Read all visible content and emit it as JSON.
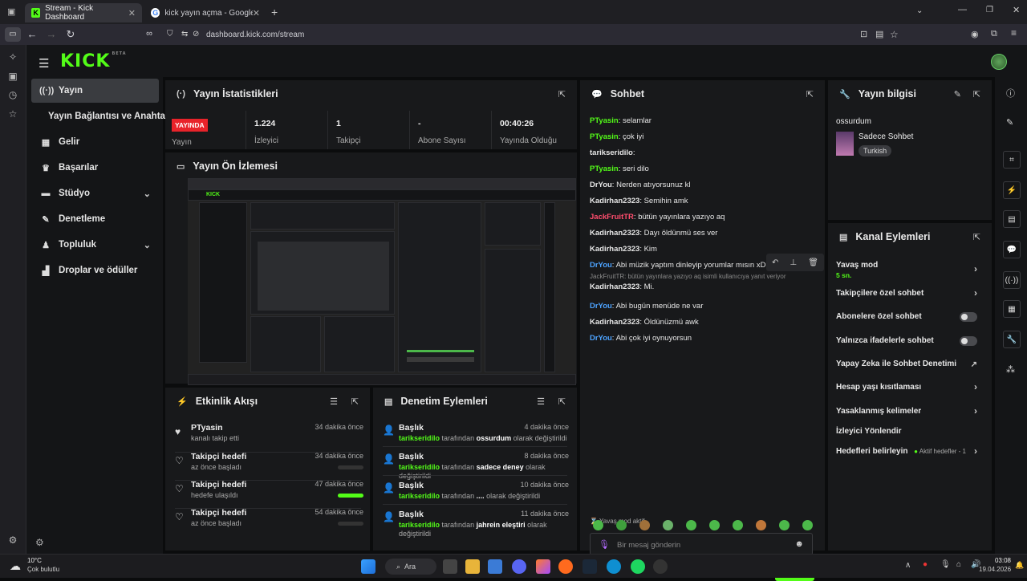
{
  "browser": {
    "tabs": [
      {
        "title": "Stream - Kick Dashboard",
        "active": true
      },
      {
        "title": "kick yayın açma - Google'da Ara",
        "active": false
      }
    ],
    "url": "dashboard.kick.com/stream"
  },
  "nav": {
    "items": [
      {
        "label": "Yayın",
        "icon": "broadcast-icon",
        "active": true
      },
      {
        "label": "Yayın Bağlantısı ve Anahtarı"
      },
      {
        "label": "Gelir",
        "icon": "revenue-icon"
      },
      {
        "label": "Başarılar",
        "icon": "trophy-icon"
      },
      {
        "label": "Stüdyo",
        "icon": "studio-icon"
      },
      {
        "label": "Denetleme",
        "icon": "wrench-icon"
      },
      {
        "label": "Topluluk",
        "icon": "community-icon"
      },
      {
        "label": "Droplar ve ödüller",
        "icon": "drops-icon"
      }
    ]
  },
  "stats": {
    "title": "Yayın İstatistikleri",
    "live_badge": "YAYINDA",
    "live_label": "Yayın",
    "cells": [
      {
        "value": "1.224",
        "label": "İzleyici"
      },
      {
        "value": "1",
        "label": "Takipçi"
      },
      {
        "value": "-",
        "label": "Abone Sayısı"
      },
      {
        "value": "00:40:26",
        "label": "Yayında Olduğu"
      }
    ]
  },
  "preview": {
    "title": "Yayın Ön İzlemesi"
  },
  "activity": {
    "title": "Etkinlik Akışı",
    "items": [
      {
        "title": "PTyasin",
        "sub": "kanalı takip etti",
        "time": "34 dakika önce",
        "progress": null
      },
      {
        "title": "Takipçi hedefi",
        "sub": "az önce başladı",
        "time": "34 dakika önce",
        "progress": 0
      },
      {
        "title": "Takipçi hedefi",
        "sub": "hedefe ulaşıldı",
        "time": "47 dakika önce",
        "progress": 1
      },
      {
        "title": "Takipçi hedefi",
        "sub": "az önce başladı",
        "time": "54 dakika önce",
        "progress": 0
      }
    ]
  },
  "moderation": {
    "title": "Denetim Eylemleri",
    "items": [
      {
        "title": "Başlık",
        "time": "4 dakika önce",
        "user": "tarikseridilo",
        "mid": "tarafından",
        "value": "ossurdum",
        "end": "olarak değiştirildi"
      },
      {
        "title": "Başlık",
        "time": "8 dakika önce",
        "user": "tarikseridilo",
        "mid": "tarafından",
        "value": "sadece deney",
        "end": "olarak değiştirildi"
      },
      {
        "title": "Başlık",
        "time": "10 dakika önce",
        "user": "tarikseridilo",
        "mid": "tarafından",
        "value": "....",
        "end": "olarak değiştirildi"
      },
      {
        "title": "Başlık",
        "time": "11 dakika önce",
        "user": "tarikseridilo",
        "mid": "tarafından",
        "value": "jahrein eleştiri",
        "end": "olarak değiştirildi"
      }
    ]
  },
  "chat": {
    "title": "Sohbet",
    "messages": [
      {
        "user": "PTyasin",
        "color": "#53fc18",
        "text": "selamlar"
      },
      {
        "user": "PTyasin",
        "color": "#53fc18",
        "text": "çok iyi"
      },
      {
        "user": "tarikseridilo",
        "color": "#e6e6e6",
        "text": ""
      },
      {
        "user": "PTyasin",
        "color": "#53fc18",
        "text": "seri dilo"
      },
      {
        "user": "DrYou",
        "color": "#e6e6e6",
        "text": "Nerden atıyorsunuz kl"
      },
      {
        "user": "Kadirhan2323",
        "color": "#e6e6e6",
        "text": "Semihin amk"
      },
      {
        "user": "JackFruitTR",
        "color": "#ff4d6d",
        "text": "bütün yayınlara yazıyo aq"
      },
      {
        "user": "Kadirhan2323",
        "color": "#e6e6e6",
        "text": "Dayı öldünmü ses ver"
      },
      {
        "user": "Kadirhan2323",
        "color": "#e6e6e6",
        "text": "Kim"
      },
      {
        "user": "DrYou",
        "color": "#4da3ff",
        "text": "Abi müzik yaptım dinleyip yorumlar mısın xD"
      },
      {
        "user": "Kadirhan2323",
        "color": "#e6e6e6",
        "text": "Mi."
      },
      {
        "user": "DrYou",
        "color": "#4da3ff",
        "text": "Abi bugün menüde ne var"
      },
      {
        "user": "Kadirhan2323",
        "color": "#e6e6e6",
        "text": "Öldünüzmü awk"
      },
      {
        "user": "DrYou",
        "color": "#4da3ff",
        "text": "Abi çok iyi oynuyorsun"
      }
    ],
    "reply_note": "JackFruitTR: bütün yayınlara yazıyo aq isimli kullanıcıya yanıt veriyor",
    "slow_mode_note": "Yavaş mod aktif",
    "input_placeholder": "Bir mesaj gönderin",
    "send_label": "Gönder"
  },
  "stream_info": {
    "title": "Yayın bilgisi",
    "stream_title": "ossurdum",
    "category": "Sadece Sohbet",
    "language": "Turkish"
  },
  "channel_actions": {
    "title": "Kanal Eylemleri",
    "rows": [
      {
        "label": "Yavaş mod",
        "sub": "5 sn.",
        "control": "chevron"
      },
      {
        "label": "Takipçilere özel sohbet",
        "control": "chevron"
      },
      {
        "label": "Abonelere özel sohbet",
        "control": "toggle"
      },
      {
        "label": "Yalnızca ifadelerle sohbet",
        "control": "toggle"
      },
      {
        "label": "Yapay Zeka ile Sohbet Denetimi",
        "control": "external"
      },
      {
        "label": "Hesap yaşı kısıtlaması",
        "control": "chevron"
      },
      {
        "label": "Yasaklanmış kelimeler",
        "control": "chevron"
      },
      {
        "label": "İzleyici Yönlendir",
        "control": "none"
      },
      {
        "label": "Hedefleri belirleyin",
        "control": "chevron",
        "note": "Aktif hedefler - 1"
      }
    ]
  },
  "taskbar": {
    "weather_temp": "10°C",
    "weather_desc": "Çok bulutlu",
    "search_label": "Ara",
    "time": "03:08",
    "date": "19.04.2026"
  }
}
